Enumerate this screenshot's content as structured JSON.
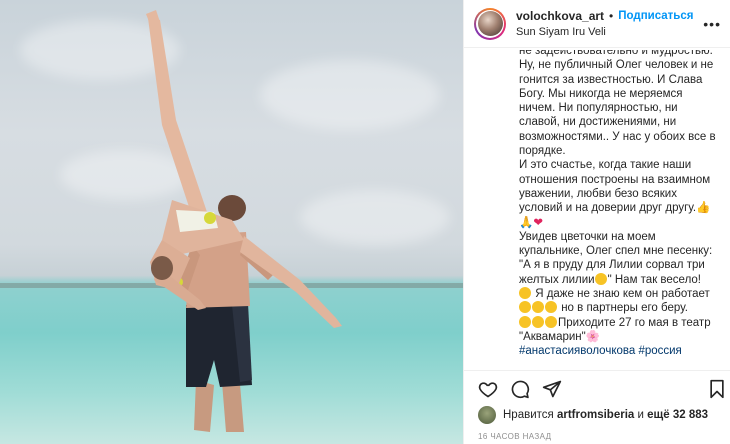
{
  "post": {
    "username": "volochkova_art",
    "separator": "•",
    "follow_label": "Подписаться",
    "location": "Sun Siyam Iru Veli",
    "more_icon": "ellipsis-icon"
  },
  "caption": {
    "partial_top": "не задействовательно и мудростью.",
    "paragraph1": "Ну, не публичный Олег человек и не гонится за известностью. И Слава Богу. Мы никогда не меряемся ничем. Ни популярностью, ни славой, ни достижениями, ни возможностями.. У нас у обоих все в порядке.",
    "paragraph2": "И это счастье, когда такие наши отношения построены на взаимном уважении, любви безо всяких условий и на доверии друг другу.",
    "paragraph3a": "Увидев цветочки на моем купальнике, Олег спел мне песенку: \"А я в пруду для Лилии сорвал три желтых лилии",
    "paragraph3b": "\" Нам так весело!",
    "paragraph4": "Я даже не знаю кем он работает",
    "paragraph5": "но в партнеры его беру.",
    "paragraph6": "Приходите 27 го мая в театр \"Аквамарин\"",
    "hashtags": "#анастасияволочкова #россия",
    "emoji": {
      "thumbs": "👍",
      "pray": "🙏",
      "heart": "❤",
      "blossom": "🌸"
    }
  },
  "actions": {
    "like_icon": "heart-icon",
    "comment_icon": "comment-icon",
    "share_icon": "share-icon",
    "save_icon": "bookmark-icon"
  },
  "likes": {
    "prefix": "Нравится",
    "liker": "artfromsiberia",
    "middle": "и",
    "rest": "ещё 32 883"
  },
  "timestamp": "16 ЧАСОВ НАЗАД",
  "colors": {
    "follow": "#0095f6",
    "hashtag": "#00376b",
    "text": "#262626",
    "muted": "#8e8e8e"
  }
}
